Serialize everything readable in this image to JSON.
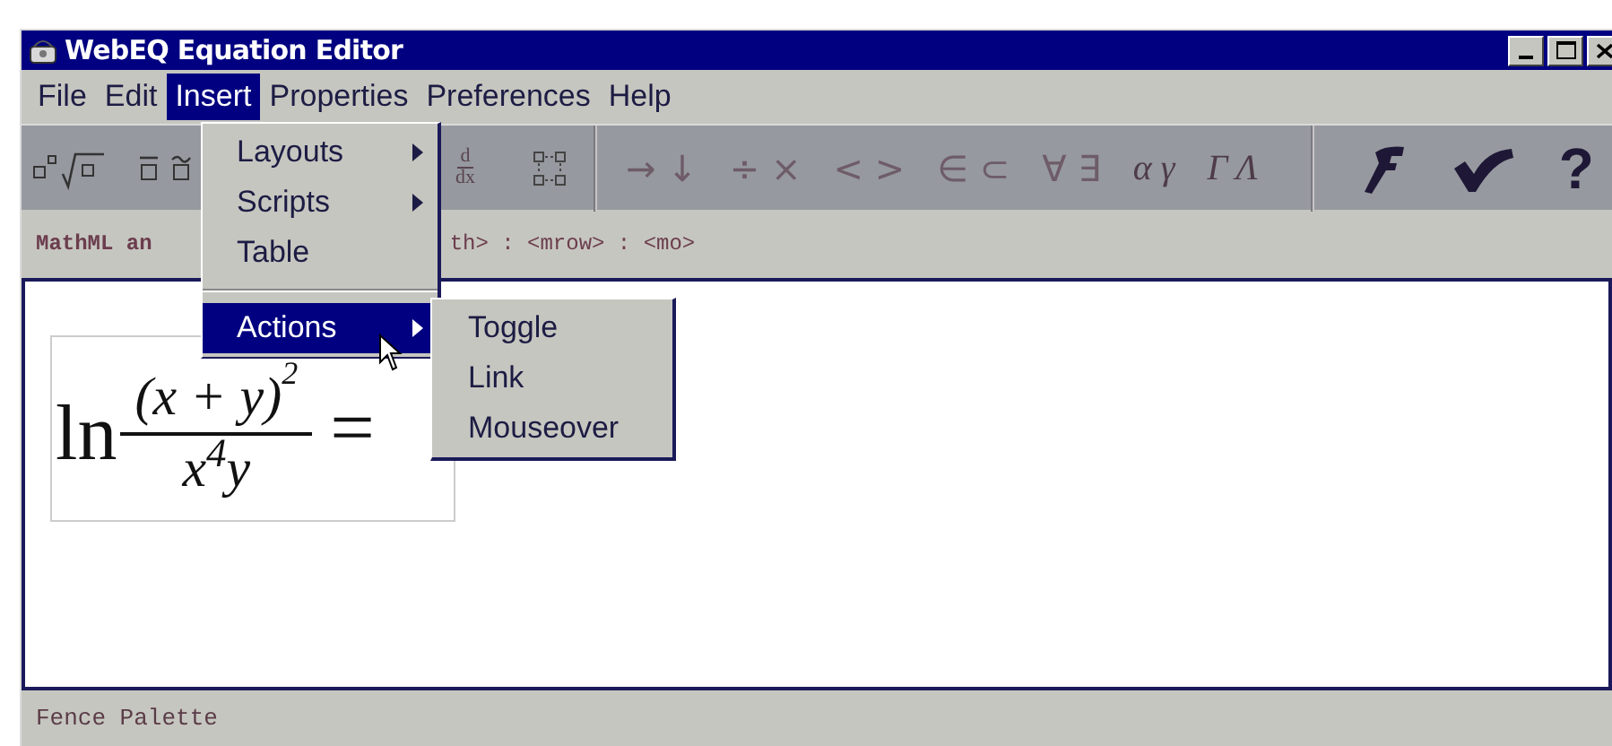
{
  "window": {
    "title": "WebEQ Equation Editor"
  },
  "menubar": [
    {
      "label": "File",
      "selected": false
    },
    {
      "label": "Edit",
      "selected": false
    },
    {
      "label": "Insert",
      "selected": true
    },
    {
      "label": "Properties",
      "selected": false
    },
    {
      "label": "Preferences",
      "selected": false
    },
    {
      "label": "Help",
      "selected": false
    }
  ],
  "toolbar": [
    {
      "kind": "icon"
    },
    {
      "kind": "icon"
    },
    {
      "kind": "fraction",
      "numerator": "d",
      "denominator": "dx"
    },
    {
      "kind": "icon"
    },
    {
      "kind": "separator"
    },
    {
      "kind": "symbols",
      "label": "→ ↓"
    },
    {
      "kind": "symbols",
      "label": "÷ ×"
    },
    {
      "kind": "symbols",
      "label": "< >"
    },
    {
      "kind": "symbols",
      "label": "∈ ⊂"
    },
    {
      "kind": "symbols",
      "label": "∀ ∃"
    },
    {
      "kind": "greek",
      "label": "α γ"
    },
    {
      "kind": "greek",
      "label": "Γ Λ"
    },
    {
      "kind": "separator"
    },
    {
      "kind": "icon"
    },
    {
      "kind": "icon"
    },
    {
      "kind": "help",
      "label": "?"
    }
  ],
  "path_bar": {
    "left": "MathML an",
    "right": "th> : <mrow> : <mo>"
  },
  "equation": {
    "function": "ln",
    "numerator": "(x + y)$^{2}$",
    "denominator": "x$^{4}$y",
    "relation": "="
  },
  "insert_menu": [
    {
      "label": "Layouts",
      "submenu": true,
      "selected": false
    },
    {
      "label": "Scripts",
      "submenu": true,
      "selected": false
    },
    {
      "label": "Table",
      "submenu": false,
      "selected": false
    },
    {
      "kind": "separator"
    },
    {
      "label": "Actions",
      "submenu": true,
      "selected": true
    }
  ],
  "actions_submenu": [
    {
      "label": "Toggle"
    },
    {
      "label": "Link"
    },
    {
      "label": "Mouseover"
    }
  ],
  "status_bar": "Fence Palette"
}
